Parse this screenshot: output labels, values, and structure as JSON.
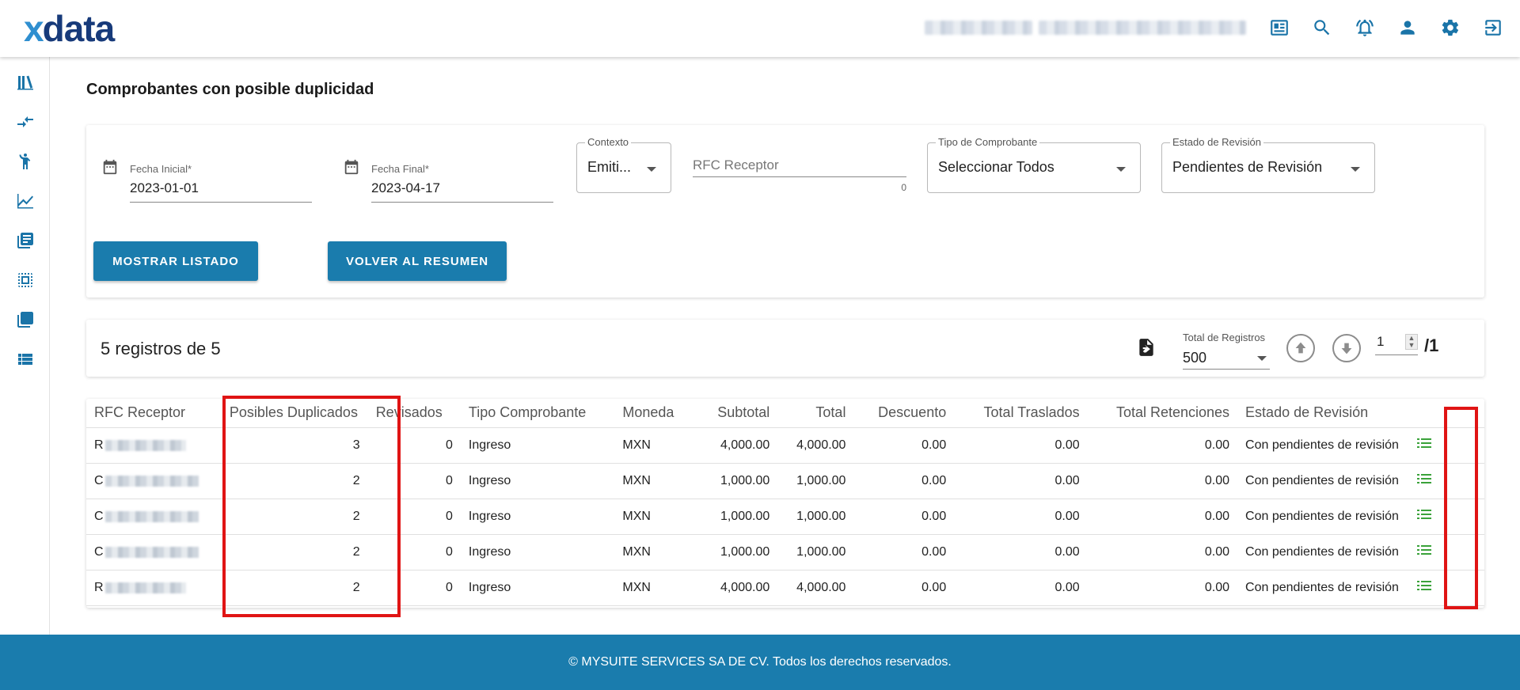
{
  "app": {
    "logo_x": "x",
    "logo_rest": "data"
  },
  "topbar": {
    "icons": [
      "news-icon",
      "search-icon",
      "alarm-bell-icon",
      "person-icon",
      "gear-icon",
      "logout-icon"
    ]
  },
  "sidebar": {
    "icons": [
      "library-icon",
      "compare-arrows-icon",
      "accessibility-icon",
      "line-chart-icon",
      "article-icon",
      "copy-check-icon",
      "layers-icon",
      "list-view-icon"
    ]
  },
  "page": {
    "title": "Comprobantes con posible duplicidad"
  },
  "filters": {
    "fecha_inicial": {
      "label": "Fecha Inicial*",
      "value": "2023-01-01"
    },
    "fecha_final": {
      "label": "Fecha Final*",
      "value": "2023-04-17"
    },
    "contexto": {
      "label": "Contexto",
      "value": "Emiti..."
    },
    "rfc_receptor": {
      "placeholder": "RFC Receptor",
      "counter": "0"
    },
    "tipo_comprobante": {
      "label": "Tipo de Comprobante",
      "value": "Seleccionar Todos"
    },
    "estado_revision": {
      "label": "Estado de Revisión",
      "value": "Pendientes de Revisión"
    },
    "btn_mostrar": "MOSTRAR LISTADO",
    "btn_volver": "VOLVER AL RESUMEN"
  },
  "summary": {
    "text": "5 registros de 5",
    "total_registros_label": "Total de Registros",
    "total_registros_value": "500",
    "page_current": "1",
    "page_total": "/1"
  },
  "table": {
    "headers": [
      "RFC Receptor",
      "Posibles Duplicados",
      "Revisados",
      "Tipo Comprobante",
      "Moneda",
      "Subtotal",
      "Total",
      "Descuento",
      "Total Traslados",
      "Total Retenciones",
      "Estado de Revisión"
    ],
    "rows": [
      {
        "rfc_initial": "R",
        "posibles": "3",
        "revisados": "0",
        "tipo": "Ingreso",
        "moneda": "MXN",
        "subtotal": "4,000.00",
        "total": "4,000.00",
        "descuento": "0.00",
        "traslados": "0.00",
        "retenciones": "0.00",
        "estado": "Con pendientes de revisión"
      },
      {
        "rfc_initial": "C",
        "posibles": "2",
        "revisados": "0",
        "tipo": "Ingreso",
        "moneda": "MXN",
        "subtotal": "1,000.00",
        "total": "1,000.00",
        "descuento": "0.00",
        "traslados": "0.00",
        "retenciones": "0.00",
        "estado": "Con pendientes de revisión"
      },
      {
        "rfc_initial": "C",
        "posibles": "2",
        "revisados": "0",
        "tipo": "Ingreso",
        "moneda": "MXN",
        "subtotal": "1,000.00",
        "total": "1,000.00",
        "descuento": "0.00",
        "traslados": "0.00",
        "retenciones": "0.00",
        "estado": "Con pendientes de revisión"
      },
      {
        "rfc_initial": "C",
        "posibles": "2",
        "revisados": "0",
        "tipo": "Ingreso",
        "moneda": "MXN",
        "subtotal": "1,000.00",
        "total": "1,000.00",
        "descuento": "0.00",
        "traslados": "0.00",
        "retenciones": "0.00",
        "estado": "Con pendientes de revisión"
      },
      {
        "rfc_initial": "R",
        "posibles": "2",
        "revisados": "0",
        "tipo": "Ingreso",
        "moneda": "MXN",
        "subtotal": "4,000.00",
        "total": "4,000.00",
        "descuento": "0.00",
        "traslados": "0.00",
        "retenciones": "0.00",
        "estado": "Con pendientes de revisión"
      }
    ],
    "row_action_icon": "list-details-icon"
  },
  "highlight": {
    "color": "#e01414"
  },
  "colors": {
    "accent": "#1a7cad",
    "icon_blue": "#1a74a8",
    "action_green": "#3aa23a"
  },
  "footer": {
    "text": "© MYSUITE SERVICES SA DE CV. Todos los derechos reservados."
  }
}
